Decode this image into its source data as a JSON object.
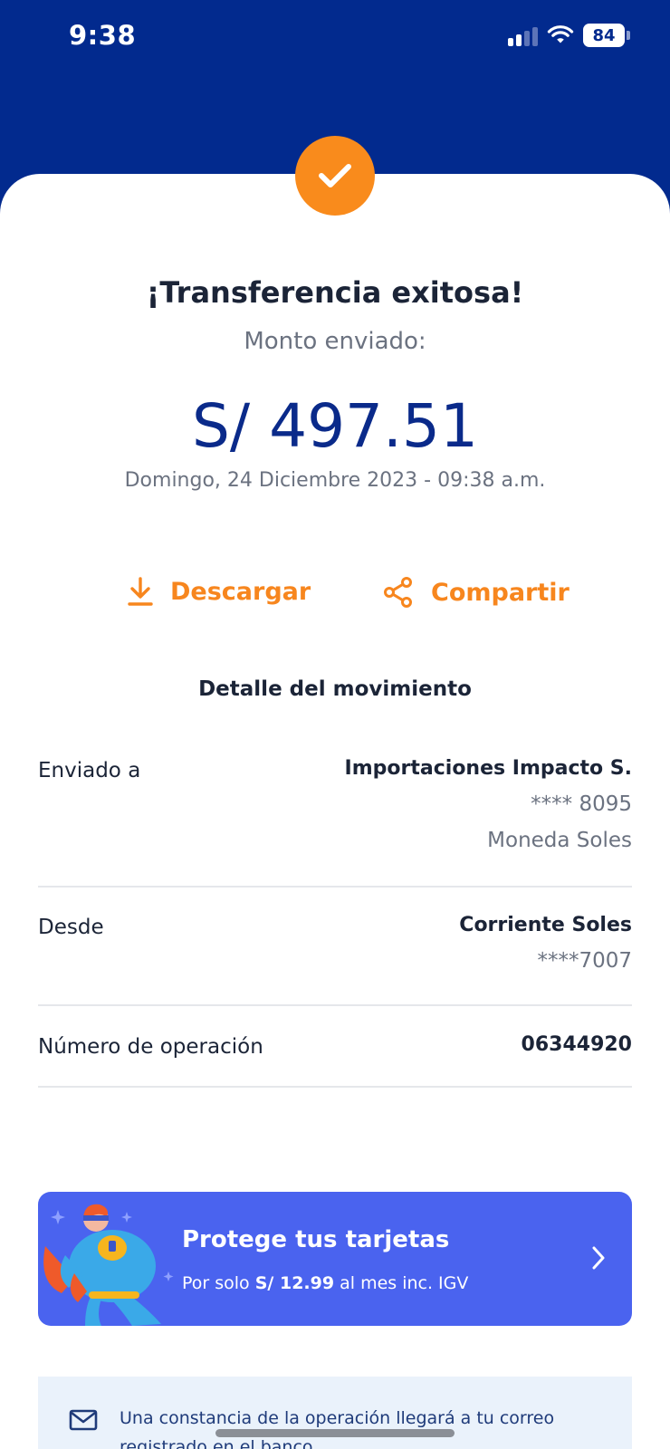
{
  "status_bar": {
    "time": "9:38",
    "battery": "84"
  },
  "result": {
    "title": "¡Transferencia exitosa!",
    "subtitle": "Monto enviado:",
    "amount": "S/ 497.51",
    "date": "Domingo, 24 Diciembre 2023 - 09:38 a.m."
  },
  "actions": {
    "download": "Descargar",
    "share": "Compartir"
  },
  "detail": {
    "title": "Detalle del movimiento",
    "rows": [
      {
        "label": "Enviado a",
        "main": "Importaciones Impacto S.",
        "subs": [
          "**** 8095",
          "Moneda Soles"
        ]
      },
      {
        "label": "Desde",
        "main": "Corriente Soles",
        "subs": [
          "****7007"
        ]
      },
      {
        "label": "Número de operación",
        "main": "06344920",
        "subs": []
      }
    ]
  },
  "promo": {
    "title": "Protege tus tarjetas",
    "sub_prefix": "Por solo ",
    "sub_price": "S/ 12.99",
    "sub_suffix": " al mes inc. IGV"
  },
  "notice": {
    "text": "Una constancia de la operación llegará a tu correo registrado en el banco"
  },
  "colors": {
    "brand_blue": "#022a8e",
    "accent_orange": "#f98b1c",
    "promo_blue": "#4a63ef"
  }
}
